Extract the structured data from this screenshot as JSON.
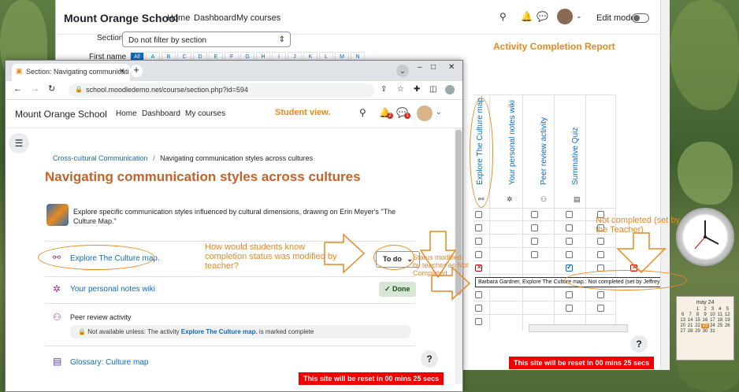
{
  "back_window": {
    "brand": "Mount Orange School",
    "nav": [
      "Home",
      "Dashboard",
      "My courses"
    ],
    "edit_mode_label": "Edit mode",
    "section_label": "Section",
    "section_select": "Do not filter by section",
    "firstname_label": "First name",
    "letters": [
      "All",
      "A",
      "B",
      "C",
      "D",
      "E",
      "F",
      "G",
      "H",
      "I",
      "J",
      "K",
      "L",
      "M",
      "N"
    ],
    "report_title": "Activity Completion Report",
    "activities": [
      "Explore The Culture map.",
      "Your personal notes wiki",
      "Peer review activity",
      "Summative Quiz"
    ],
    "tooltip": "Barbara Gardner, Explore The Culture map.: Not completed (set by Jeffrey Sanders)",
    "reset_banner": "This site will be reset in 00 mins 25 secs",
    "help": "?"
  },
  "front_window": {
    "tab_title": "Section: Navigating communicati",
    "url": "school.moodledemo.net/course/section.php?id=594",
    "brand": "Mount Orange School",
    "nav": [
      "Home",
      "Dashboard",
      "My courses"
    ],
    "student_view_label": "Student view.",
    "notif_count": "2",
    "msg_count": "1",
    "breadcrumb": {
      "course": "Cross-cultural Communication",
      "separator": "/",
      "section": "Navigating communication styles across cultures"
    },
    "page_title": "Navigating communication styles across cultures",
    "intro": "Explore specific communication styles influenced by cultural dimensions, drawing on Erin Meyer's \"The Culture Map.\"",
    "activities": [
      {
        "name": "Explore The Culture map.",
        "status": "To do"
      },
      {
        "name": "Your personal notes wiki",
        "status": "Done"
      },
      {
        "name": "Peer review activity",
        "restriction_prefix": "Not available unless: The activity",
        "restriction_link": "Explore The Culture map.",
        "restriction_suffix": "is marked complete"
      },
      {
        "name": "Glossary: Culture map"
      }
    ],
    "help": "?",
    "reset_banner": "This site will be reset in 00 mins 25 secs"
  },
  "annotations": {
    "question": "How would students know completion status was modified by teacher?",
    "status_modified": "Status modified by teacher as Not Completed.",
    "not_completed": "Not completed (set by the Teacher)"
  },
  "calendar": {
    "month": "may 24",
    "days": [
      "",
      "",
      "1",
      "2",
      "3",
      "4",
      "5",
      "6",
      "7",
      "8",
      "9",
      "10",
      "11",
      "12",
      "13",
      "14",
      "15",
      "16",
      "17",
      "18",
      "19",
      "20",
      "21",
      "22",
      "23",
      "24",
      "25",
      "26",
      "27",
      "28",
      "29",
      "30",
      "31",
      "",
      ""
    ],
    "today": "23"
  },
  "colors": {
    "accent_orange": "#e8891f",
    "moodle_blue": "#0f6cbf",
    "title_brown": "#c0642b",
    "reset_red": "#ee0000"
  }
}
